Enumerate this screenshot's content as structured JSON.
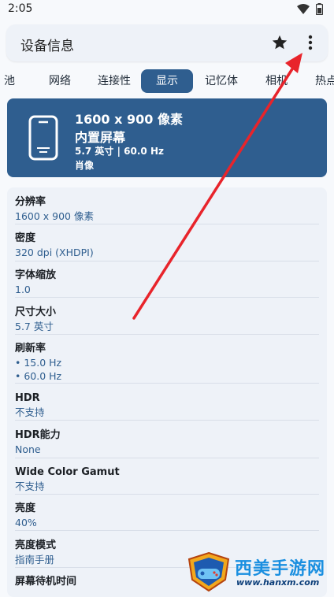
{
  "status": {
    "time": "2:05"
  },
  "app": {
    "title": "设备信息"
  },
  "tabs": [
    {
      "label": "池"
    },
    {
      "label": "网络"
    },
    {
      "label": "连接性"
    },
    {
      "label": "显示",
      "active": true
    },
    {
      "label": "记忆体"
    },
    {
      "label": "相机"
    },
    {
      "label": "热点"
    }
  ],
  "hero": {
    "resolution": "1600 x 900 像素",
    "screen_type": "内置屏幕",
    "meta": "5.7 英寸 | 60.0 Hz",
    "orientation": "肖像"
  },
  "info_rows": [
    {
      "label": "分辨率",
      "value": "1600 x 900 像素"
    },
    {
      "label": "密度",
      "value": "320 dpi (XHDPI)"
    },
    {
      "label": "字体缩放",
      "value": "1.0"
    },
    {
      "label": "尺寸大小",
      "value": "5.7 英寸"
    },
    {
      "label": "刷新率",
      "value": "• 15.0 Hz",
      "value2": "• 60.0 Hz"
    },
    {
      "label": "HDR",
      "value": "不支持"
    },
    {
      "label": "HDR能力",
      "value": "None"
    },
    {
      "label": "Wide Color Gamut",
      "value": "不支持"
    },
    {
      "label": "亮度",
      "value": "40%"
    },
    {
      "label": "亮度模式",
      "value": "指南手册"
    },
    {
      "label": "屏幕待机时间",
      "value": ""
    }
  ],
  "watermark": {
    "brand": "西美手游网",
    "url": "www.hanxm.com"
  },
  "colors": {
    "accent": "#2f5e8f",
    "annotation_arrow": "#e8242b"
  },
  "icons": [
    "wifi-icon",
    "battery-icon",
    "star-icon",
    "more-vert-icon",
    "phone-screen-icon"
  ]
}
